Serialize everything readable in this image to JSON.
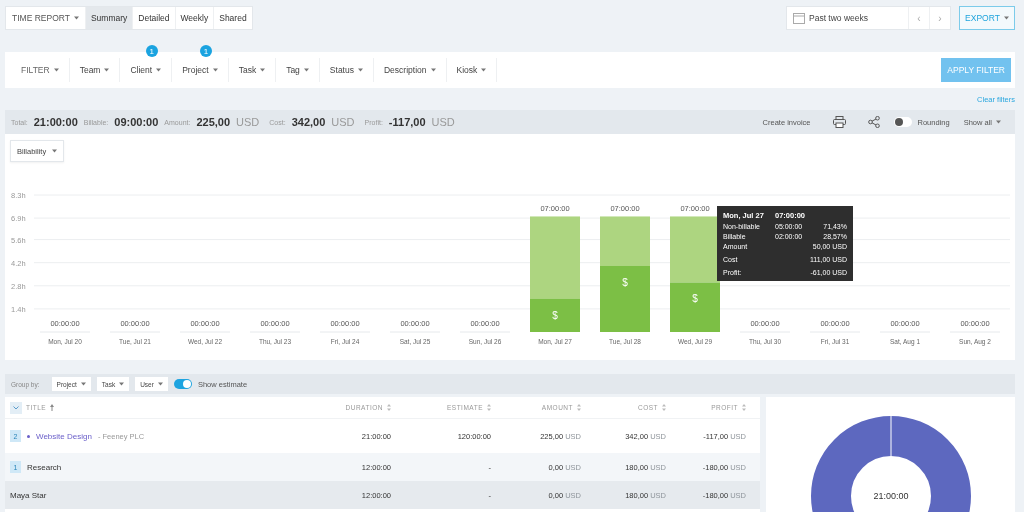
{
  "header": {
    "report_menu": "TIME REPORT",
    "tabs": [
      {
        "label": "Summary",
        "selected": true
      },
      {
        "label": "Detailed",
        "selected": false
      },
      {
        "label": "Weekly",
        "selected": false
      },
      {
        "label": "Shared",
        "selected": false
      }
    ],
    "date_range": "Past two weeks",
    "prev": "‹",
    "next": "›",
    "export": "EXPORT"
  },
  "filters": {
    "label": "FILTER",
    "items": [
      {
        "label": "Team"
      },
      {
        "label": "Client",
        "badge": "1"
      },
      {
        "label": "Project",
        "badge": "1"
      },
      {
        "label": "Task"
      },
      {
        "label": "Tag"
      },
      {
        "label": "Status"
      },
      {
        "label": "Description"
      },
      {
        "label": "Kiosk"
      }
    ],
    "apply": "APPLY FILTER",
    "clear": "Clear filters"
  },
  "totals": [
    {
      "label": "Total:",
      "value": "21:00:00"
    },
    {
      "label": "Billable:",
      "value": "09:00:00"
    },
    {
      "label": "Amount:",
      "value": "225,00",
      "unit": "USD"
    },
    {
      "label": "Cost:",
      "value": "342,00",
      "unit": "USD"
    },
    {
      "label": "Profit:",
      "value": "-117,00",
      "unit": "USD"
    }
  ],
  "toolbar": {
    "create_invoice": "Create invoice",
    "rounding": {
      "label": "Rounding",
      "on": false
    },
    "show_all": "Show all"
  },
  "chart": {
    "mode": "Billability",
    "billable_mark": "$",
    "chart_data": {
      "type": "bar",
      "stacked": true,
      "categories": [
        "Mon, Jul 20",
        "Tue, Jul 21",
        "Wed, Jul 22",
        "Thu, Jul 23",
        "Fri, Jul 24",
        "Sat, Jul 25",
        "Sun, Jul 26",
        "Mon, Jul 27",
        "Tue, Jul 28",
        "Wed, Jul 29",
        "Thu, Jul 30",
        "Fri, Jul 31",
        "Sat, Aug 1",
        "Sun, Aug 2"
      ],
      "series": [
        {
          "name": "Non-billable",
          "color": "#add580",
          "values": [
            0,
            0,
            0,
            0,
            0,
            0,
            0,
            5,
            3,
            4,
            0,
            0,
            0,
            0
          ]
        },
        {
          "name": "Billable",
          "color": "#7cbf45",
          "values": [
            0,
            0,
            0,
            0,
            0,
            0,
            0,
            2,
            4,
            3,
            0,
            0,
            0,
            0
          ]
        }
      ],
      "grid": true,
      "ylim": [
        0,
        8.3
      ],
      "yticks": [
        {
          "value": 1.4,
          "label": "1.4h"
        },
        {
          "value": 2.8,
          "label": "2.8h"
        },
        {
          "value": 4.2,
          "label": "4.2h"
        },
        {
          "value": 5.6,
          "label": "5.6h"
        },
        {
          "value": 6.9,
          "label": "6.9h"
        },
        {
          "value": 8.3,
          "label": "8.3h"
        }
      ],
      "value_labels": [
        "00:00:00",
        "00:00:00",
        "00:00:00",
        "00:00:00",
        "00:00:00",
        "00:00:00",
        "00:00:00",
        "07:00:00",
        "07:00:00",
        "07:00:00",
        "00:00:00",
        "00:00:00",
        "00:00:00",
        "00:00:00"
      ]
    },
    "tooltip": {
      "date": "Mon, Jul 27",
      "total": "07:00:00",
      "rows": [
        {
          "kind": "series",
          "time": "05:00:00",
          "value": "71,43%"
        },
        {
          "kind": "series",
          "time": "02:00:00",
          "value": "28,57%"
        },
        {
          "label": "Amount",
          "value": "50,00 USD"
        },
        {
          "label": "Cost",
          "value": "111,00 USD"
        },
        {
          "label": "Profit:",
          "value": "-61,00 USD"
        }
      ]
    }
  },
  "group_by": {
    "label": "Group by:",
    "options": [
      "Project",
      "Task",
      "User"
    ],
    "estimate": {
      "label": "Show estimate",
      "on": true
    }
  },
  "table": {
    "columns": [
      {
        "label": "TITLE",
        "sorted": true
      },
      {
        "label": "DURATION",
        "sorted": false
      },
      {
        "label": "ESTIMATE",
        "sorted": false
      },
      {
        "label": "AMOUNT",
        "sorted": false
      },
      {
        "label": "COST",
        "sorted": false
      },
      {
        "label": "PROFIT",
        "sorted": false
      }
    ],
    "rows": [
      {
        "kind": "project",
        "count": "2",
        "title": "Website Design",
        "client": "- Feeney PLC",
        "color": "#6a5fc9",
        "duration": "21:00:00",
        "estimate": "120:00:00",
        "amount": {
          "value": "225,00",
          "unit": "USD"
        },
        "cost": {
          "value": "342,00",
          "unit": "USD"
        },
        "profit": {
          "value": "-117,00",
          "unit": "USD"
        },
        "children": [
          {
            "kind": "task",
            "count": "1",
            "title": "Research",
            "duration": "12:00:00",
            "estimate": "-",
            "amount": {
              "value": "0,00",
              "unit": "USD"
            },
            "cost": {
              "value": "180,00",
              "unit": "USD"
            },
            "profit": {
              "value": "-180,00",
              "unit": "USD"
            },
            "children": [
              {
                "kind": "user",
                "title": "Maya Star",
                "duration": "12:00:00",
                "estimate": "-",
                "amount": {
                  "value": "0,00",
                  "unit": "USD"
                },
                "cost": {
                  "value": "180,00",
                  "unit": "USD"
                },
                "profit": {
                  "value": "-180,00",
                  "unit": "USD"
                }
              }
            ]
          }
        ]
      }
    ]
  },
  "donut": {
    "center": "21:00:00"
  }
}
